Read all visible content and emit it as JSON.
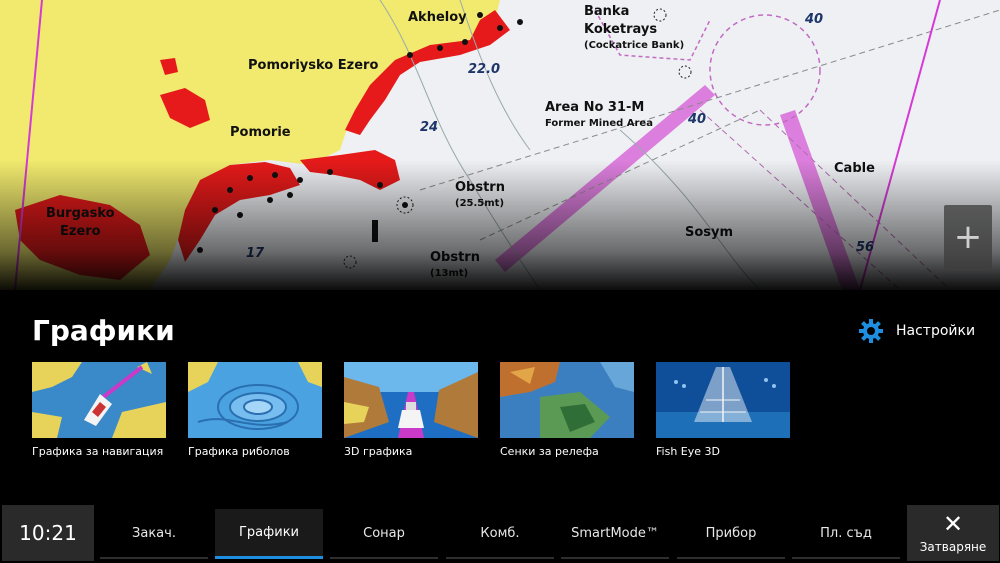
{
  "map": {
    "labels": {
      "akheloy": "Akheloy",
      "banka": "Banka",
      "koketrays": "Koketrays",
      "cockatrice": "(Cockatrice Bank)",
      "pomoriysko": "Pomoriysko Ezero",
      "pomorie": "Pomorie",
      "area": "Area No 31-M",
      "former_mined": "Former Mined Area",
      "obstrn1": "Obstrn",
      "obstrn1_depth": "(25.5mt)",
      "obstrn2": "Obstrn",
      "obstrn2_depth": "(13mt)",
      "sosym": "Sosym",
      "cable": "Cable",
      "burgasko": "Burgasko",
      "ezero": "Ezero",
      "depth_40a": "40",
      "depth_40b": "40",
      "depth_24": "24",
      "depth_220": "22.0",
      "depth_17": "17",
      "depth_56": "56"
    },
    "zoom_in_label": "+"
  },
  "panel": {
    "title": "Графики",
    "settings_label": "Настройки",
    "tiles": [
      {
        "caption": "Графика за навигация"
      },
      {
        "caption": "Графика риболов"
      },
      {
        "caption": "3D графика"
      },
      {
        "caption": "Сенки за релефа"
      },
      {
        "caption": "Fish Eye 3D"
      }
    ]
  },
  "bottom_bar": {
    "time": "10:21",
    "tabs": [
      {
        "label": "Закач."
      },
      {
        "label": "Графики"
      },
      {
        "label": "Сонар"
      },
      {
        "label": "Комб."
      },
      {
        "label": "SmartMode™"
      },
      {
        "label": "Прибор"
      },
      {
        "label": "Пл. съд"
      }
    ],
    "active_tab": "Графики",
    "close_label": "Затваряне"
  },
  "colors": {
    "land": "#f1ea6e",
    "restricted": "#e61a1a",
    "magenta": "#d63ad6",
    "accent": "#1e8fe0"
  }
}
